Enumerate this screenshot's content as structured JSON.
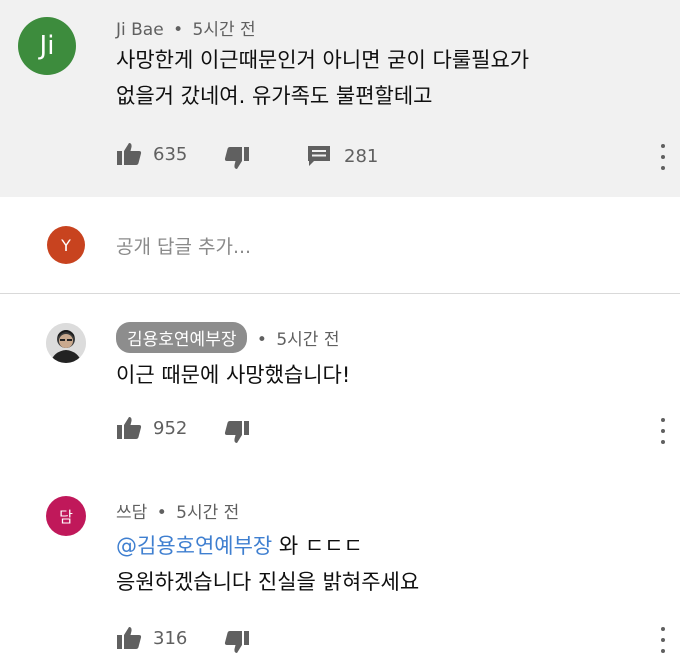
{
  "comments": [
    {
      "avatar_letter": "Ji",
      "avatar_color": "#3d8c3d",
      "author": "Ji Bae",
      "time": "5시간 전",
      "lines": [
        "사망한게 이근때문인거 아니면 굳이 다룰필요가",
        "없을거 갔네여. 유가족도 불편할테고"
      ],
      "likes": "635",
      "replies": "281"
    },
    {
      "author": "김용호연예부장",
      "time": "5시간 전",
      "lines": [
        "이근 때문에 사망했습니다!"
      ],
      "likes": "952"
    },
    {
      "avatar_letter": "담",
      "avatar_color": "#c0185a",
      "author": "쓰담",
      "time": "5시간 전",
      "mention": "@김용호연예부장",
      "line1_rest": " 와 ㄷㄷㄷ",
      "line2": "응원하겠습니다 진실을 밝혀주세요",
      "likes": "316"
    }
  ],
  "reply_box": {
    "avatar_letter": "Y",
    "avatar_color": "#c8431f",
    "placeholder": "공개 답글 추가..."
  },
  "separator": "•",
  "icons": [
    "thumbs-up-icon",
    "thumbs-down-icon",
    "reply-comment-icon",
    "more-options-icon"
  ]
}
